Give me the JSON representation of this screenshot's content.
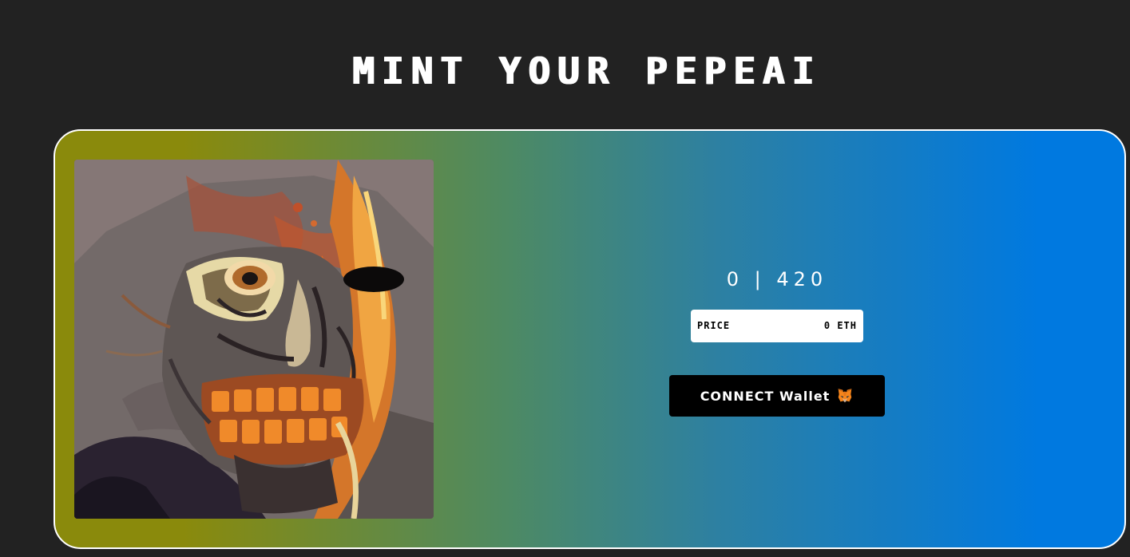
{
  "header": {
    "title": "MINT YOUR PEPEAI"
  },
  "mint": {
    "supply_text": "0 | 420",
    "price_label": "PRICE",
    "price_value": "0 ETH",
    "connect_label": "CONNECT Wallet",
    "connect_icon": "metamask-fox-icon",
    "artwork": "nft-preview-artwork"
  },
  "colors": {
    "background": "#222222",
    "gradient_start": "#8a8a0c",
    "gradient_end": "#0079e0",
    "button": "#000000",
    "price_box": "#ffffff"
  }
}
